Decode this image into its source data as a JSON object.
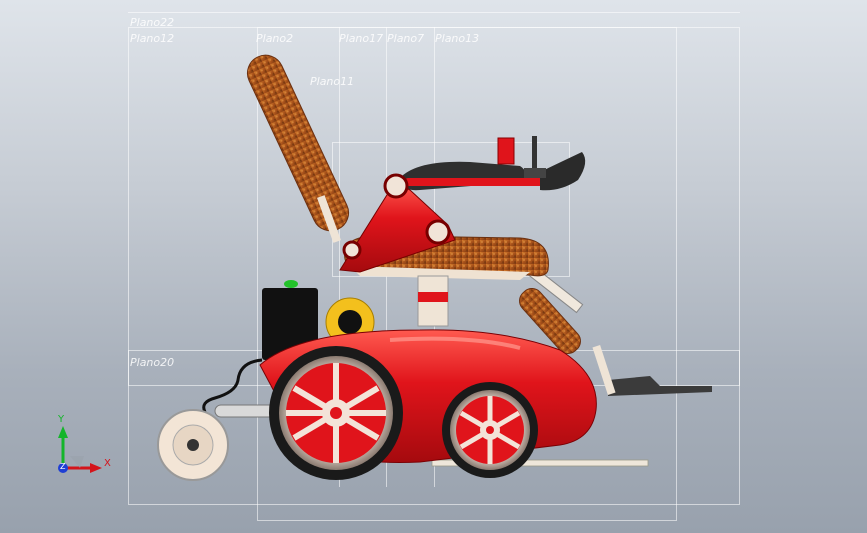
{
  "planes": {
    "plano22": "Plano22",
    "plano12": "Plano12",
    "plano2": "Plano2",
    "plano17": "Plano17",
    "plano7": "Plano7",
    "plano13": "Plano13",
    "plano11": "Plano11",
    "plano20": "Plano20"
  },
  "triad": {
    "x_label": "X",
    "y_label": "Y",
    "z_label": "Z"
  },
  "colors": {
    "frame_red": "#e0141b",
    "upholstery": "#c0621f",
    "viewport_top": "#dfe4ea"
  },
  "icons": {
    "triad": "coordinate-triad-icon"
  }
}
